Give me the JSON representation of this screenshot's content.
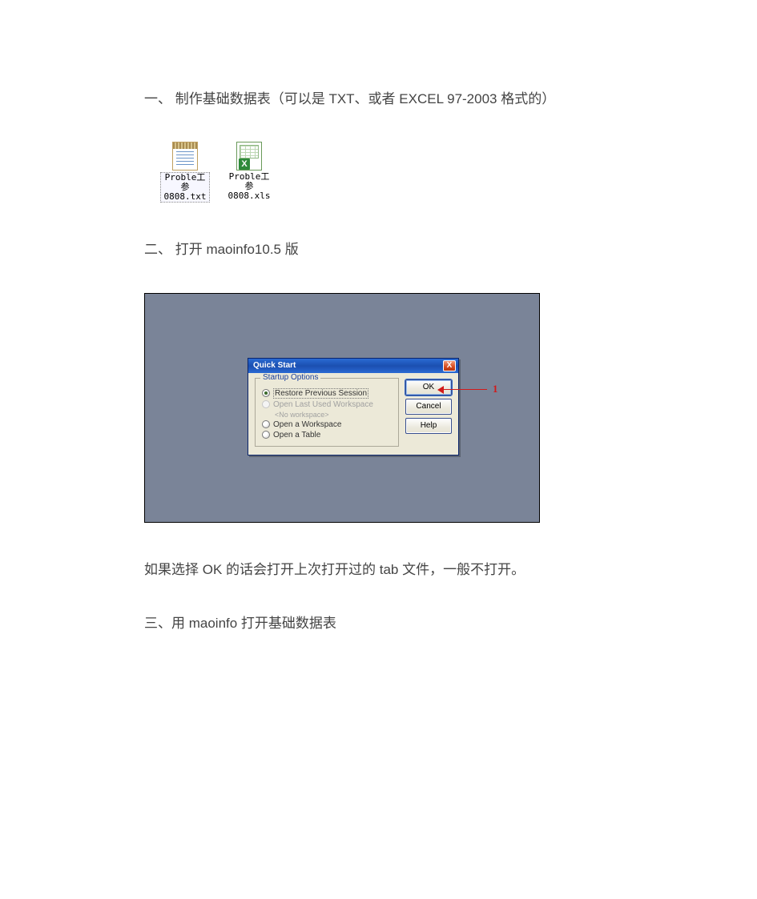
{
  "sections": {
    "one": "一、 制作基础数据表（可以是 TXT、或者 EXCEL 97-2003 格式的）",
    "two": "二、 打开 maoinfo10.5 版",
    "note": "如果选择 OK 的话会打开上次打开过的 tab 文件，一般不打开。",
    "three": "三、用 maoinfo 打开基础数据表"
  },
  "files": {
    "txt": {
      "line1": "Proble工参",
      "line2": "0808.txt"
    },
    "xls": {
      "line1": "Proble工参",
      "line2": "0808.xls"
    }
  },
  "dialog": {
    "title": "Quick Start",
    "close": "X",
    "group_title": "Startup Options",
    "opt_restore": "Restore Previous Session",
    "opt_last": "Open Last Used Workspace",
    "opt_last_sub": "<No workspace>",
    "opt_workspace": "Open a Workspace",
    "opt_table": "Open a Table",
    "btn_ok": "OK",
    "btn_cancel": "Cancel",
    "btn_help": "Help"
  },
  "annotation": {
    "label": "1"
  }
}
